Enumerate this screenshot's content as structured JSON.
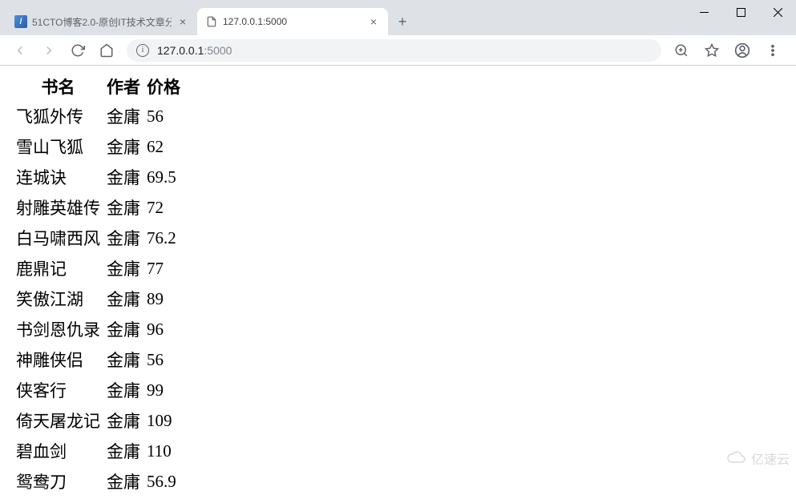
{
  "window": {
    "tabs": [
      {
        "title": "51CTO博客2.0-原创IT技术文章分",
        "active": false
      },
      {
        "title": "127.0.0.1:5000",
        "active": true
      }
    ],
    "address": {
      "host": "127.0.0.1",
      "port": ":5000"
    }
  },
  "books": {
    "headers": {
      "name": "书名",
      "author": "作者",
      "price": "价格"
    },
    "rows": [
      {
        "name": "飞狐外传",
        "author": "金庸",
        "price": "56"
      },
      {
        "name": "雪山飞狐",
        "author": "金庸",
        "price": "62"
      },
      {
        "name": "连城诀",
        "author": "金庸",
        "price": "69.5"
      },
      {
        "name": "射雕英雄传",
        "author": "金庸",
        "price": "72"
      },
      {
        "name": "白马啸西风",
        "author": "金庸",
        "price": "76.2"
      },
      {
        "name": "鹿鼎记",
        "author": "金庸",
        "price": "77"
      },
      {
        "name": "笑傲江湖",
        "author": "金庸",
        "price": "89"
      },
      {
        "name": "书剑恩仇录",
        "author": "金庸",
        "price": "96"
      },
      {
        "name": "神雕侠侣",
        "author": "金庸",
        "price": "56"
      },
      {
        "name": "侠客行",
        "author": "金庸",
        "price": "99"
      },
      {
        "name": "倚天屠龙记",
        "author": "金庸",
        "price": "109"
      },
      {
        "name": "碧血剑",
        "author": "金庸",
        "price": "110"
      },
      {
        "name": "鸳鸯刀",
        "author": "金庸",
        "price": "56.9"
      }
    ]
  },
  "watermark": "亿速云"
}
